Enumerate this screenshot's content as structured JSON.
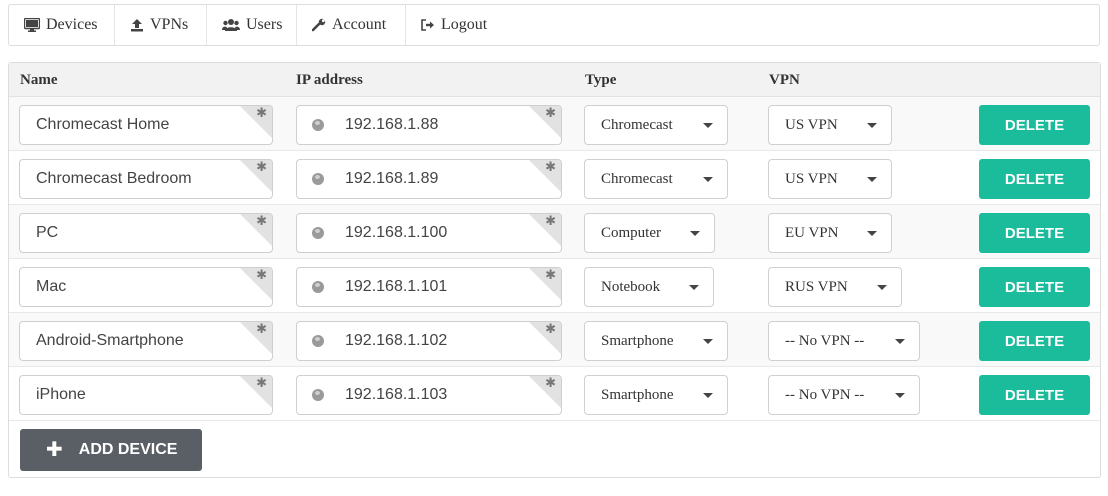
{
  "nav": [
    {
      "icon": "monitor-icon",
      "label": "Devices"
    },
    {
      "icon": "upload-icon",
      "label": "VPNs"
    },
    {
      "icon": "users-icon",
      "label": "Users"
    },
    {
      "icon": "wrench-icon",
      "label": "Account"
    },
    {
      "icon": "logout-icon",
      "label": "Logout"
    }
  ],
  "table": {
    "headers": {
      "name": "Name",
      "ip": "IP address",
      "type": "Type",
      "vpn": "VPN"
    },
    "rows": [
      {
        "name": "Chromecast Home",
        "ip": "192.168.1.88",
        "type": "Chromecast",
        "vpn": "US VPN",
        "delete": "DELETE"
      },
      {
        "name": "Chromecast Bedroom",
        "ip": "192.168.1.89",
        "type": "Chromecast",
        "vpn": "US VPN",
        "delete": "DELETE"
      },
      {
        "name": "PC",
        "ip": "192.168.1.100",
        "type": "Computer",
        "vpn": "EU VPN",
        "delete": "DELETE"
      },
      {
        "name": "Mac",
        "ip": "192.168.1.101",
        "type": "Notebook",
        "vpn": "RUS VPN",
        "delete": "DELETE"
      },
      {
        "name": "Android-Smartphone",
        "ip": "192.168.1.102",
        "type": "Smartphone",
        "vpn": "-- No VPN --",
        "delete": "DELETE"
      },
      {
        "name": "iPhone",
        "ip": "192.168.1.103",
        "type": "Smartphone",
        "vpn": "-- No VPN --",
        "delete": "DELETE"
      }
    ]
  },
  "add_device": {
    "icon": "plus-icon",
    "label": "ADD DEVICE"
  },
  "colors": {
    "accent": "#1abc9c",
    "add_button": "#5a5f65",
    "header_bg": "#f2f2f2"
  }
}
